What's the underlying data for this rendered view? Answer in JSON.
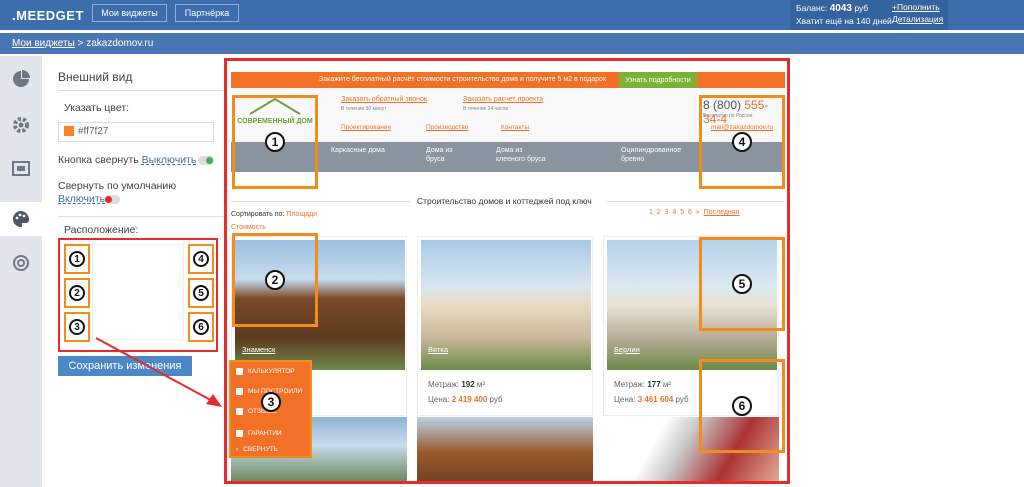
{
  "topbar": {
    "logo": ".MEEDGET",
    "btn_widgets": "Мои виджеты",
    "btn_partner": "Партнёрка",
    "balance_label": "Баланс:",
    "balance_value": "4043",
    "balance_currency": "руб",
    "balance_days": "Хватит ещё на 140 дней",
    "topup": "+Пополнить",
    "details": "Детализация"
  },
  "breadcrumb": {
    "root": "Мои виджеты",
    "sep": ">",
    "current": "zakazdomov.ru"
  },
  "settings": {
    "title": "Внешний вид",
    "color_label": "Указать цвет:",
    "color_value": "#ff7f27",
    "collapse_btn_label": "Кнопка свернуть",
    "collapse_btn_link": "Выключить",
    "collapse_default_label": "Свернуть по умолчанию",
    "collapse_default_link": "Включить",
    "position_label": "Расположение:",
    "save": "Сохранить изменения",
    "slots": [
      "1",
      "2",
      "3",
      "4",
      "5",
      "6"
    ]
  },
  "preview": {
    "promo_text": "Закажите бесплатный расчёт стоимости строительства дома и получите 5 м2 в подарок",
    "promo_button": "Узнать подробности",
    "site_logo": "СОВРЕМЕННЫЙ ДОМ",
    "callback": "Заказать обратный звонок",
    "callback_sub": "В течение 30 минут",
    "calc": "Заказать расчет проекта",
    "calc_sub": "В течение 24 часов",
    "menu": [
      "Проектирование",
      "Производство",
      "Контакты"
    ],
    "phone_prefix": "8 (800)",
    "phone_num": "555-34-4",
    "phone_sub": "Бесплатно по России",
    "email": "mail@zakazdomov.ru",
    "categories": [
      "Каркасные дома",
      "Дома из бруса",
      "Дома из клееного бруса",
      "Оцилиндрованное бревно"
    ],
    "heading": "Строительство домов и коттеджей под ключ",
    "sort_label": "Сортировать по:",
    "sort_area": "Площади",
    "sort_cost": "Стоимость",
    "pages": [
      "1",
      "2",
      "3",
      "4",
      "5",
      "6",
      "»",
      "Последняя"
    ],
    "cards": [
      {
        "name": "Знаменск",
        "area_label": "",
        "area": "",
        "price_label": "",
        "price": "",
        "currency": ""
      },
      {
        "name": "Вятка",
        "area_label": "Метраж:",
        "area": "192",
        "unit": "м²",
        "price_label": "Цена:",
        "price": "2 419 400",
        "currency": "руб"
      },
      {
        "name": "Берлин",
        "area_label": "Метраж:",
        "area": "177",
        "unit": "м²",
        "price_label": "Цена:",
        "price": "3 461 604",
        "currency": "руб"
      }
    ],
    "widget": [
      "КАЛЬКУЛЯТОР",
      "МЫ ПОСТРОИЛИ",
      "ОТЗЫВЫ",
      "ГАРАНТИИ",
      "СВЕРНУТЬ"
    ],
    "markers": [
      "1",
      "2",
      "3",
      "4",
      "5",
      "6"
    ]
  },
  "colors": {
    "accent": "#f27127",
    "brand": "#3c6eae",
    "highlight": "#e52b2b",
    "marker": "#f28c1a"
  }
}
